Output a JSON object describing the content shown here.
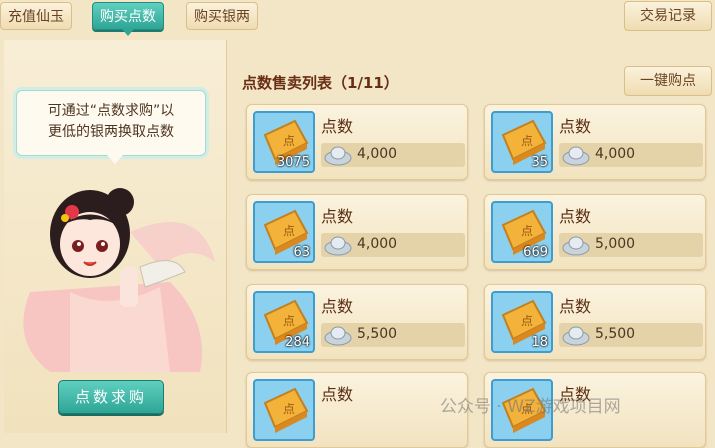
{
  "tabs": [
    {
      "label": "充值仙玉"
    },
    {
      "label": "购买点数"
    },
    {
      "label": "购买银两"
    }
  ],
  "history_button": "交易记录",
  "bubble": {
    "line1": "可通过“点数求购”以",
    "line2": "更低的银两换取点数"
  },
  "seek_button": "点数求购",
  "list_title": "点数售卖列表（1/11）",
  "onekey_button": "一键购点",
  "listings": [
    {
      "name": "点数",
      "qty": "3075",
      "price": "4,000"
    },
    {
      "name": "点数",
      "qty": "35",
      "price": "4,000"
    },
    {
      "name": "点数",
      "qty": "63",
      "price": "4,000"
    },
    {
      "name": "点数",
      "qty": "669",
      "price": "5,000"
    },
    {
      "name": "点数",
      "qty": "284",
      "price": "5,500"
    },
    {
      "name": "点数",
      "qty": "18",
      "price": "5,500"
    },
    {
      "name": "点数",
      "qty": "",
      "price": ""
    },
    {
      "name": "点数",
      "qty": "",
      "price": ""
    }
  ],
  "watermark": "公众号 · WZ游戏项目网",
  "colors": {
    "accent": "#2ea596",
    "panel": "#f3e6c6",
    "card_border": "#3d9dcf"
  }
}
